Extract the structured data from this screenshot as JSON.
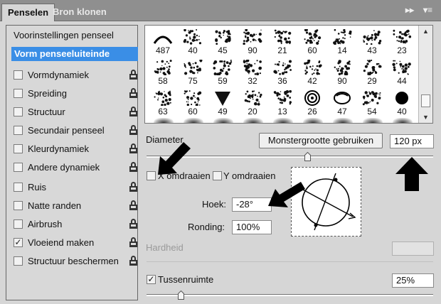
{
  "tabs": [
    {
      "label": "Penselen",
      "active": true
    },
    {
      "label": "Bron klonen",
      "active": false
    }
  ],
  "panel_controls": {
    "expand": "▸▸",
    "menu": "▾≡"
  },
  "left_panel": {
    "preset_link": "Voorinstellingen penseel",
    "selected_item": "Vorm penseeluiteinde",
    "items": [
      {
        "label": "Vormdynamiek",
        "checked": false
      },
      {
        "label": "Spreiding",
        "checked": false
      },
      {
        "label": "Structuur",
        "checked": false
      },
      {
        "label": "Secundair penseel",
        "checked": false
      },
      {
        "label": "Kleurdynamiek",
        "checked": false
      },
      {
        "label": "Andere dynamiek",
        "checked": false
      },
      {
        "label": "Ruis",
        "checked": false
      },
      {
        "label": "Natte randen",
        "checked": false
      },
      {
        "label": "Airbrush",
        "checked": false
      },
      {
        "label": "Vloeiend maken",
        "checked": true
      },
      {
        "label": "Structuur beschermen",
        "checked": false
      }
    ]
  },
  "brush_sizes": [
    [
      "487",
      "40",
      "45",
      "90",
      "21",
      "60",
      "14",
      "43",
      "23"
    ],
    [
      "58",
      "75",
      "59",
      "32",
      "36",
      "42",
      "90",
      "29",
      "44"
    ],
    [
      "63",
      "60",
      "49",
      "20",
      "13",
      "26",
      "47",
      "54",
      "40"
    ]
  ],
  "brush_tip": {
    "diameter_label": "Diameter",
    "sample_size_button": "Monstergrootte gebruiken",
    "diameter_value": "120 px",
    "diameter_slider_fraction": 0.56,
    "flip_x_label": "X omdraaien",
    "flip_x_checked": false,
    "flip_y_label": "Y omdraaien",
    "flip_y_checked": false,
    "angle_label": "Hoek:",
    "angle_value": "-28°",
    "roundness_label": "Ronding:",
    "roundness_value": "100%",
    "hardness_label": "Hardheid",
    "hardness_value": "",
    "spacing_label": "Tussenruimte",
    "spacing_checked": true,
    "spacing_value": "25%",
    "spacing_slider_fraction": 0.12
  },
  "colors": {
    "selection": "#3a8ee6",
    "tabbar": "#8f8f8f",
    "panel": "#d6d6d6",
    "annotation_arrow": "#000000"
  },
  "icons": [
    "lock-icon",
    "checkmark-icon",
    "brush-angle-preview",
    "annotation-arrow"
  ]
}
